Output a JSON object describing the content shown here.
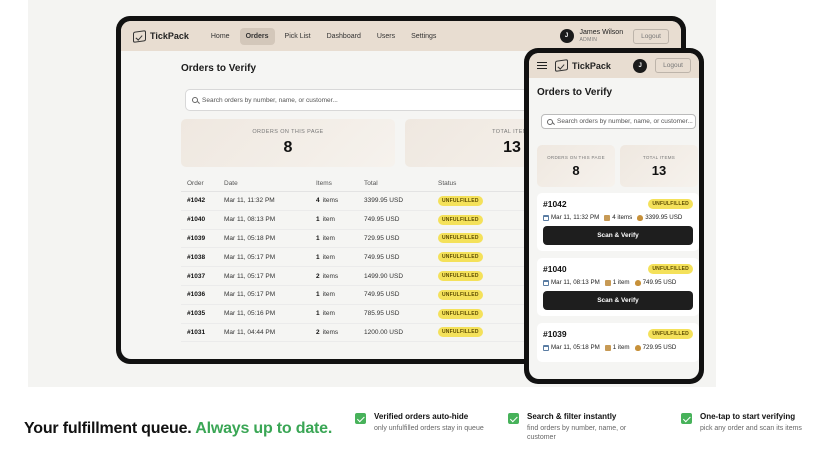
{
  "app": {
    "name": "TickPack"
  },
  "nav": {
    "items": [
      "Home",
      "Orders",
      "Pick List",
      "Dashboard",
      "Users",
      "Settings"
    ],
    "active": "Orders"
  },
  "user": {
    "initial": "J",
    "name": "James Wilson",
    "role": "ADMIN",
    "logout": "Logout"
  },
  "page": {
    "title": "Orders to Verify",
    "search_placeholder": "Search orders by number, name, or customer..."
  },
  "stats": {
    "on_page_label": "ORDERS ON THIS PAGE",
    "on_page_value": "8",
    "total_label": "TOTAL ITEMS",
    "total_value": "13"
  },
  "table": {
    "headers": [
      "Order",
      "Date",
      "Items",
      "Total",
      "Status"
    ],
    "rows": [
      {
        "order": "#1042",
        "date": "Mar 11, 11:32 PM",
        "qty": "4",
        "unit": "items",
        "total": "3399.95 USD",
        "status": "UNFULFILLED"
      },
      {
        "order": "#1040",
        "date": "Mar 11, 08:13 PM",
        "qty": "1",
        "unit": "item",
        "total": "749.95 USD",
        "status": "UNFULFILLED"
      },
      {
        "order": "#1039",
        "date": "Mar 11, 05:18 PM",
        "qty": "1",
        "unit": "item",
        "total": "729.95 USD",
        "status": "UNFULFILLED"
      },
      {
        "order": "#1038",
        "date": "Mar 11, 05:17 PM",
        "qty": "1",
        "unit": "item",
        "total": "749.95 USD",
        "status": "UNFULFILLED"
      },
      {
        "order": "#1037",
        "date": "Mar 11, 05:17 PM",
        "qty": "2",
        "unit": "items",
        "total": "1499.90 USD",
        "status": "UNFULFILLED"
      },
      {
        "order": "#1036",
        "date": "Mar 11, 05:17 PM",
        "qty": "1",
        "unit": "item",
        "total": "749.95 USD",
        "status": "UNFULFILLED"
      },
      {
        "order": "#1035",
        "date": "Mar 11, 05:16 PM",
        "qty": "1",
        "unit": "item",
        "total": "785.95 USD",
        "status": "UNFULFILLED"
      },
      {
        "order": "#1031",
        "date": "Mar 11, 04:44 PM",
        "qty": "2",
        "unit": "items",
        "total": "1200.00 USD",
        "status": "UNFULFILLED"
      }
    ]
  },
  "mobile": {
    "search_placeholder": "Search orders by number, name, or customer...",
    "stats": {
      "on_page_label": "ORDERS ON THIS PAGE",
      "total_label": "TOTAL ITEMS"
    },
    "scan_label": "Scan & Verify",
    "cards": [
      {
        "order": "#1042",
        "status": "UNFULFILLED",
        "date": "Mar 11, 11:32 PM",
        "items": "4 items",
        "total": "3399.95 USD"
      },
      {
        "order": "#1040",
        "status": "UNFULFILLED",
        "date": "Mar 11, 08:13 PM",
        "items": "1 item",
        "total": "749.95 USD"
      },
      {
        "order": "#1039",
        "status": "UNFULFILLED",
        "date": "Mar 11, 05:18 PM",
        "items": "1 item",
        "total": "729.95 USD"
      }
    ]
  },
  "tagline": {
    "main": "Your fulfillment queue.",
    "accent": "Always up to date."
  },
  "features": [
    {
      "title": "Verified orders auto-hide",
      "subtitle": "only unfulfilled orders stay in queue"
    },
    {
      "title": "Search & filter instantly",
      "subtitle": "find orders by number, name, or customer"
    },
    {
      "title": "One-tap to start verifying",
      "subtitle": "pick any order and scan its items"
    }
  ],
  "colors": {
    "accent": "#3aa655",
    "nav_bg": "#e8ddd1",
    "badge": "#f4e15a",
    "check": "#47b25a"
  },
  "icons": [
    "tickpack-logo-icon",
    "search-icon",
    "menu-icon",
    "calendar-icon",
    "package-icon",
    "money-bag-icon",
    "checkmark-icon"
  ]
}
